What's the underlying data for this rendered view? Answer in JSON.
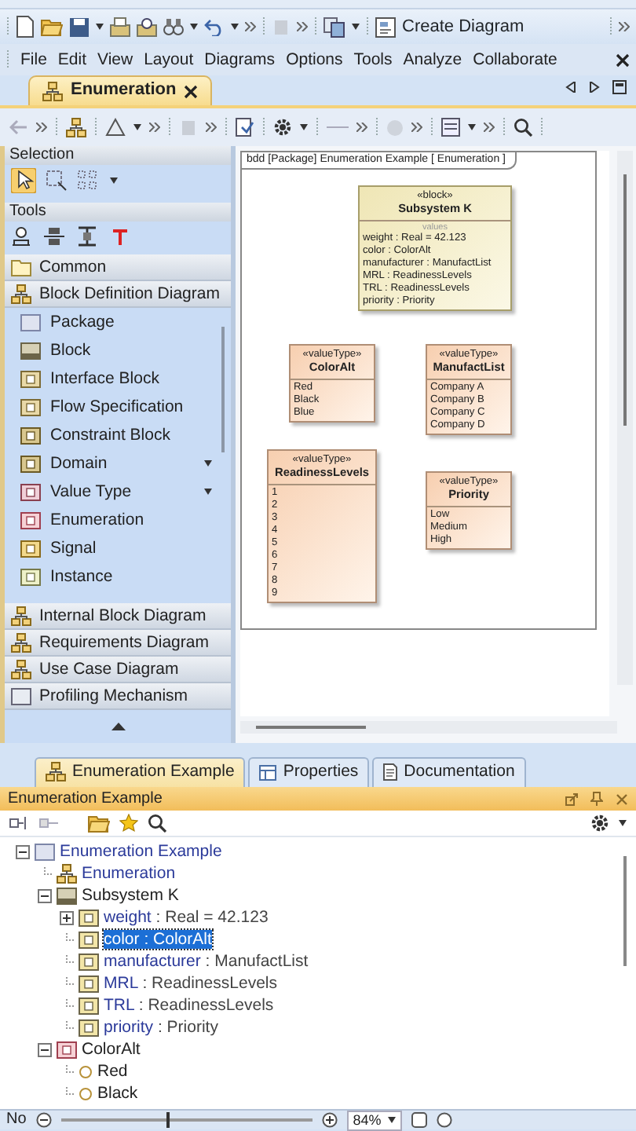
{
  "toolbar": {
    "create_diagram": "Create Diagram"
  },
  "menu": [
    {
      "label": "File"
    },
    {
      "label": "Edit"
    },
    {
      "label": "View"
    },
    {
      "label": "Layout"
    },
    {
      "label": "Diagrams"
    },
    {
      "label": "Options"
    },
    {
      "label": "Tools"
    },
    {
      "label": "Analyze"
    },
    {
      "label": "Collaborate"
    }
  ],
  "editor_tabs": [
    {
      "label": "Enumeration",
      "selected": true
    }
  ],
  "palette": {
    "selection_title": "Selection",
    "tools_title": "Tools",
    "selection_tools": [
      {
        "kind": "pointer",
        "selected": true
      },
      {
        "kind": "marquee",
        "selected": false
      },
      {
        "kind": "grid",
        "selected": false
      }
    ],
    "groups": [
      {
        "label": "Common",
        "kind": "folder"
      },
      {
        "label": "Block Definition Diagram",
        "kind": "bdd",
        "items": [
          {
            "label": "Package",
            "kind": "package",
            "submenu": false
          },
          {
            "label": "Block",
            "kind": "block",
            "submenu": false
          },
          {
            "label": "Interface Block",
            "kind": "interface",
            "submenu": false
          },
          {
            "label": "Flow Specification",
            "kind": "interface",
            "submenu": false
          },
          {
            "label": "Constraint Block",
            "kind": "constraint",
            "submenu": false
          },
          {
            "label": "Domain",
            "kind": "constraint",
            "submenu": true
          },
          {
            "label": "Value Type",
            "kind": "valuetype",
            "submenu": true
          },
          {
            "label": "Enumeration",
            "kind": "enumeration",
            "submenu": false
          },
          {
            "label": "Signal",
            "kind": "signal",
            "submenu": false
          },
          {
            "label": "Instance",
            "kind": "instance",
            "submenu": false
          }
        ]
      },
      {
        "label": "Internal Block Diagram",
        "kind": "ibd"
      },
      {
        "label": "Requirements Diagram",
        "kind": "req"
      },
      {
        "label": "Use Case Diagram",
        "kind": "usecase"
      },
      {
        "label": "Profiling Mechanism",
        "kind": "profile"
      }
    ]
  },
  "diagram": {
    "frame_label": "bdd [Package] Enumeration Example [ Enumeration ]",
    "elements": [
      {
        "kind": "block",
        "stereotype": "«block»",
        "name": "Subsystem K",
        "compartment": "values",
        "entries": [
          "weight : Real = 42.123",
          "color : ColorAlt",
          "manufacturer : ManufactList",
          "MRL : ReadinessLevels",
          "TRL : ReadinessLevels",
          "priority : Priority"
        ]
      },
      {
        "kind": "valuetype",
        "stereotype": "«valueType»",
        "name": "ColorAlt",
        "entries": [
          "Red",
          "Black",
          "Blue"
        ]
      },
      {
        "kind": "valuetype",
        "stereotype": "«valueType»",
        "name": "ManufactList",
        "entries": [
          "Company A",
          "Company B",
          "Company C",
          "Company D"
        ]
      },
      {
        "kind": "valuetype",
        "stereotype": "«valueType»",
        "name": "ReadinessLevels",
        "entries": [
          "1",
          "2",
          "3",
          "4",
          "5",
          "6",
          "7",
          "8",
          "9"
        ]
      },
      {
        "kind": "valuetype",
        "stereotype": "«valueType»",
        "name": "Priority",
        "entries": [
          "Low",
          "Medium",
          "High"
        ]
      }
    ]
  },
  "bottom_tabs": [
    {
      "label": "Enumeration Example",
      "kind": "containment",
      "selected": true
    },
    {
      "label": "Properties",
      "kind": "properties",
      "selected": false
    },
    {
      "label": "Documentation",
      "kind": "documentation",
      "selected": false
    }
  ],
  "panel": {
    "title": "Enumeration Example",
    "tree": [
      {
        "kind": "package",
        "name": "Enumeration Example",
        "selected": false,
        "expanded": true,
        "children": [
          {
            "kind": "diagram",
            "name": "Enumeration",
            "selected": false
          },
          {
            "kind": "block",
            "name": "Subsystem K",
            "selected": false,
            "expanded": true,
            "children": [
              {
                "kind": "property",
                "name": "weight",
                "type": ": Real = 42.123",
                "selected": false,
                "expanded": false
              },
              {
                "kind": "property",
                "name": "color",
                "type": ": ColorAlt",
                "selected": true
              },
              {
                "kind": "property",
                "name": "manufacturer",
                "type": ": ManufactList",
                "selected": false
              },
              {
                "kind": "property",
                "name": "MRL",
                "type": ": ReadinessLevels",
                "selected": false
              },
              {
                "kind": "property",
                "name": "TRL",
                "type": ": ReadinessLevels",
                "selected": false
              },
              {
                "kind": "property",
                "name": "priority",
                "type": ": Priority",
                "selected": false
              }
            ]
          },
          {
            "kind": "enumeration",
            "name": "ColorAlt",
            "selected": false,
            "expanded": true,
            "children": [
              {
                "kind": "literal",
                "name": "Red",
                "selected": false
              },
              {
                "kind": "literal",
                "name": "Black",
                "selected": false
              }
            ]
          }
        ]
      }
    ]
  },
  "status_bar": {
    "text": "No",
    "zoom": "84%",
    "zoom_slider": {
      "level": 0.42
    }
  }
}
